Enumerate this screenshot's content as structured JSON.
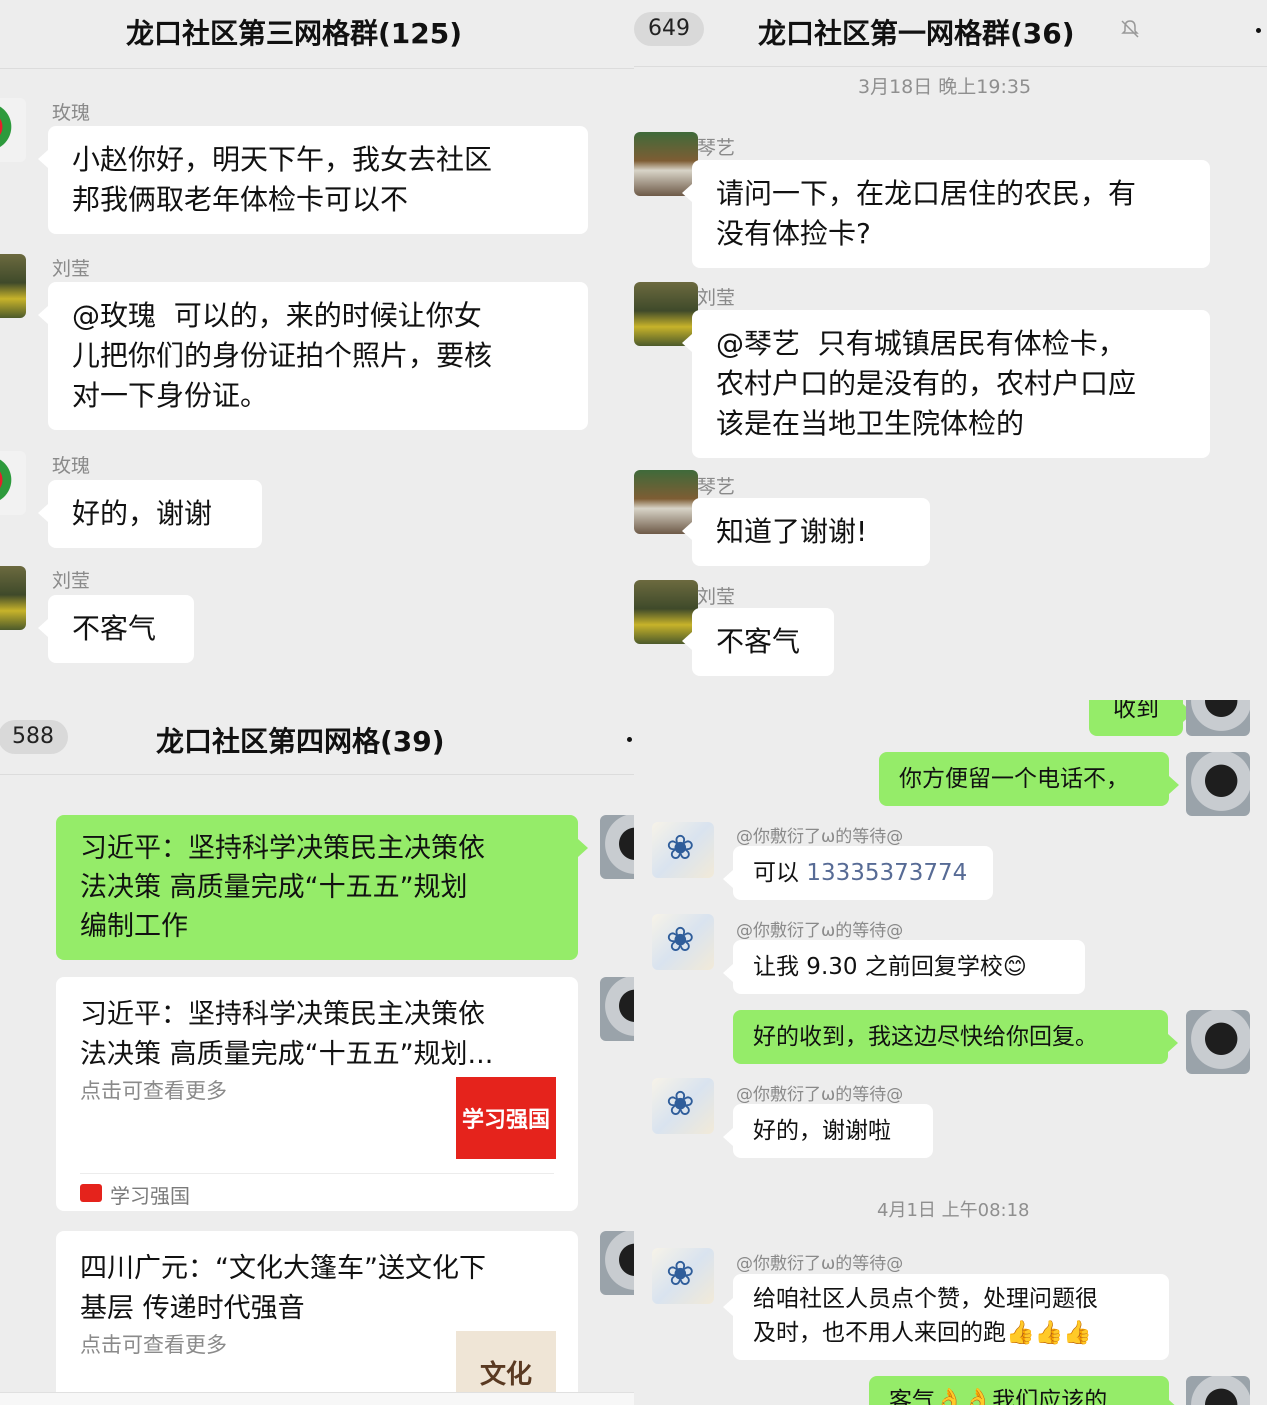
{
  "panel1": {
    "title": "龙口社区第三网格群(125)",
    "messages": [
      {
        "sender": "玫瑰",
        "text": "小赵你好，明天下午，我女去社区\n邦我俩取老年体检卡可以不"
      },
      {
        "sender": "刘莹",
        "text": "@玫瑰  可以的，来的时候让你女\n儿把你们的身份证拍个照片，要核\n对一下身份证。"
      },
      {
        "sender": "玫瑰",
        "text": "好的，谢谢"
      },
      {
        "sender": "刘莹",
        "text": "不客气"
      }
    ]
  },
  "panel2": {
    "unread": "649",
    "title": "龙口社区第一网格群(36)",
    "timestamp": "3月18日 晚上19:35",
    "messages": [
      {
        "sender": "琴艺",
        "text": "请问一下，在龙口居住的农民，有\n没有体捡卡?"
      },
      {
        "sender": "刘莹",
        "text": "@琴艺  只有城镇居民有体检卡，\n农村户口的是没有的，农村户口应\n该是在当地卫生院体检的"
      },
      {
        "sender": "琴艺",
        "text": "知道了谢谢!"
      },
      {
        "sender": "刘莹",
        "text": "不客气"
      }
    ]
  },
  "panel3": {
    "unread": "588",
    "title": "龙口社区第四网格(39)",
    "message_text": "习近平：坚持科学决策民主决策依\n法决策 高质量完成“十五五”规划\n编制工作",
    "cards": [
      {
        "title": "习近平：坚持科学决策民主决策依\n法决策 高质量完成“十五五”规划...",
        "subtitle": "点击可查看更多",
        "thumb": "学习强国",
        "source": "学习强国"
      },
      {
        "title": "四川广元：“文化大篷车”送文化下\n基层 传递时代强音",
        "subtitle": "点击可查看更多",
        "thumb": "文化"
      }
    ]
  },
  "panel4": {
    "self_top": "收到",
    "self_phone_request": "你方便留一个电话不，",
    "mention_name": "@你敷衍了ω的等待@",
    "reply1_prefix": "可以 ",
    "reply1_phone": "13335373774",
    "reply2": "让我 9.30 之前回复学校😊",
    "self_ok": "好的收到，我这边尽快给你回复。",
    "reply3": "好的，谢谢啦",
    "timestamp": "4月1日 上午08:18",
    "reply4": "给咱社区人员点个赞，处理问题很\n及时，也不用人来回的跑👍👍👍",
    "self_bottom": "客气👌👌我们应该的"
  }
}
